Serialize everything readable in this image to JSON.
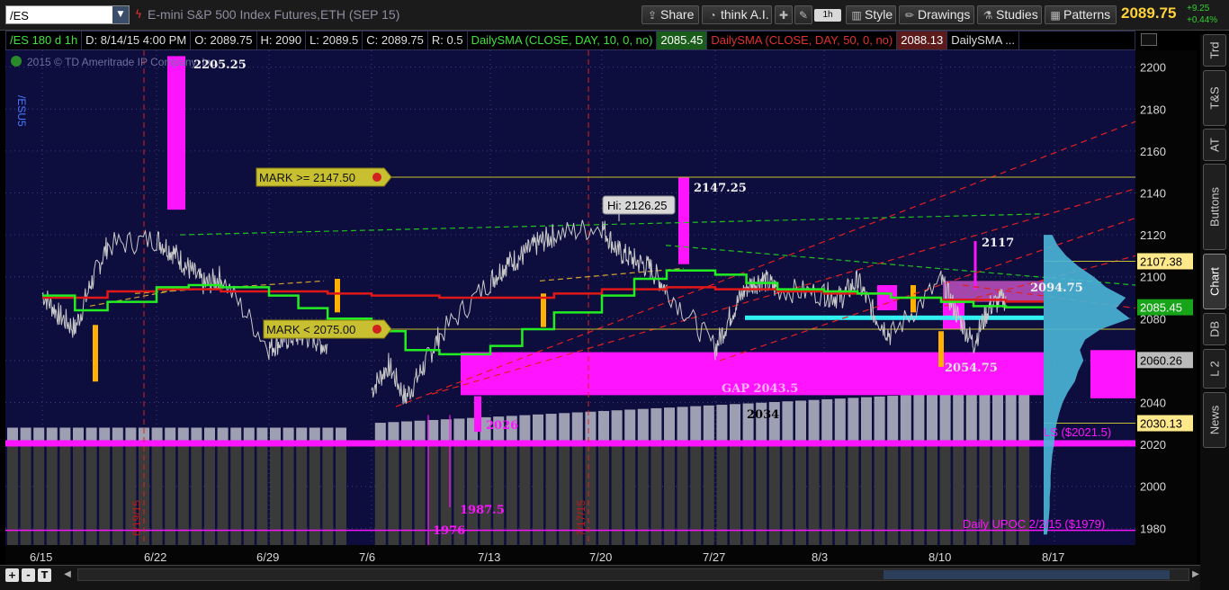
{
  "header": {
    "symbol": "/ES",
    "instrument_title": "E-mini S&P 500 Index Futures,ETH (SEP 15)",
    "share_label": "Share",
    "think_ai_label": "think A.I.",
    "timeframe_label": "1h",
    "style_label": "Style",
    "drawings_label": "Drawings",
    "studies_label": "Studies",
    "patterns_label": "Patterns",
    "last_price": "2089.75",
    "change": "+9.25",
    "change_pct": "+0.44%"
  },
  "infobar": {
    "symbol_tf": "/ES 180 d 1h",
    "date": "D: 8/14/15 4:00 PM",
    "open": "O: 2089.75",
    "high": "H: 2090",
    "low": "L: 2089.5",
    "close": "C: 2089.75",
    "range": "R: 0.5",
    "sma10_label": "DailySMA (CLOSE, DAY, 10, 0, no)",
    "sma10_value": "2085.45",
    "sma50_label": "DailySMA (CLOSE, DAY, 50, 0, no)",
    "sma50_value": "2088.13",
    "sma_more": "DailySMA ..."
  },
  "side_tabs": [
    "Trd",
    "T&S",
    "AT",
    "Buttons",
    "Chart",
    "DB",
    "L 2",
    "News"
  ],
  "active_tab": "Chart",
  "bottom_tools": {
    "zoom_in": "+",
    "zoom_out": "-",
    "text": "T"
  },
  "colors": {
    "background": "#0e0e3e",
    "sma10": "#22ee22",
    "sma50": "#e01818",
    "price": "#c9c9c9",
    "magenta": "#ff14ff",
    "volume_profile": "#4ab6d8",
    "mark_line": "#c8c030",
    "bubble_bg": "#c8c030",
    "bubble_text": "#111111",
    "label_white": "#f0f0f0",
    "cyan_band": "#30f0f0",
    "orange_bar": "#ffb000",
    "last_price_up": "#ffd23a",
    "change_up": "#2fd12f"
  },
  "chart_data": {
    "type": "line",
    "watermark": "2015 © TD Ameritrade IP Company, Inc.",
    "side_label": "/ESU5",
    "ylim": [
      1972,
      2208
    ],
    "y_ticks": [
      2200,
      2180,
      2160,
      2140,
      2120,
      2100,
      2080,
      2060,
      2040,
      2020,
      2000,
      1980
    ],
    "x_ticks": [
      "6/15",
      "6/22",
      "6/29",
      "7/6",
      "7/13",
      "7/20",
      "7/27",
      "8/3",
      "8/10",
      "8/17"
    ],
    "vertical_markers": [
      "6/19/15",
      "7/17/15"
    ],
    "annotations": [
      "2205.25",
      "2147.25",
      "Hi: 2126.25",
      "2117",
      "2094.75",
      "GAP 2043.5",
      "2034",
      "2026",
      "2054.75",
      "1987.5",
      "1976"
    ],
    "alerts": [
      "MARK >= 2147.50",
      "MARK < 2075.00"
    ],
    "price_tags": [
      {
        "label": "2107.38",
        "value": 2107.38,
        "color": "#ffe98a"
      },
      {
        "label": "2085.45",
        "value": 2085.45,
        "color": "#18a418"
      },
      {
        "label": "2060.26",
        "value": 2060.26,
        "color": "#bbbbbb"
      },
      {
        "label": "2030.13",
        "value": 2030.13,
        "color": "#ffe98a"
      }
    ],
    "profile_labels": [
      "LS ($2021.5)",
      "Daily UPOC 2/2/15 ($1979)"
    ],
    "horizontal_levels": {
      "mark_high": 2147.5,
      "mark_low": 2075.0,
      "ls": 2021.5,
      "upoc": 1979
    },
    "series": [
      {
        "name": "DailySMA (CLOSE, DAY, 10, 0, no)",
        "x": [
          "6/15",
          "6/17",
          "6/19",
          "6/22",
          "6/24",
          "6/26",
          "6/29",
          "7/1",
          "7/3",
          "7/6",
          "7/8",
          "7/10",
          "7/13",
          "7/15",
          "7/17",
          "7/20",
          "7/22",
          "7/24",
          "7/27",
          "7/29",
          "7/31",
          "8/3",
          "8/5",
          "8/7",
          "8/10",
          "8/12",
          "8/14"
        ],
        "y": [
          2091,
          2084,
          2088,
          2095,
          2096,
          2095,
          2091,
          2085,
          2080,
          2074,
          2065,
          2063,
          2067,
          2075,
          2083,
          2091,
          2099,
          2103,
          2101,
          2097,
          2094,
          2093,
          2092,
          2090,
          2088,
          2086,
          2085.45
        ]
      },
      {
        "name": "DailySMA (CLOSE, DAY, 50, 0, no)",
        "x": [
          "6/15",
          "6/19",
          "6/22",
          "6/26",
          "6/29",
          "7/3",
          "7/6",
          "7/10",
          "7/13",
          "7/17",
          "7/20",
          "7/24",
          "7/27",
          "7/31",
          "8/3",
          "8/7",
          "8/10",
          "8/14"
        ],
        "y": [
          2090,
          2093,
          2094,
          2093,
          2093,
          2092,
          2091,
          2090,
          2090,
          2092,
          2094,
          2095,
          2094,
          2093,
          2092,
          2090,
          2089,
          2088.13
        ]
      },
      {
        "name": "/ES",
        "x": [
          "6/15",
          "6/16",
          "6/17",
          "6/18",
          "6/19",
          "6/22",
          "6/23",
          "6/24",
          "6/25",
          "6/26",
          "6/29",
          "6/30",
          "7/1",
          "7/2",
          "7/3",
          "7/6",
          "7/7",
          "7/8",
          "7/9",
          "7/10",
          "7/13",
          "7/14",
          "7/15",
          "7/16",
          "7/17",
          "7/20",
          "7/21",
          "7/22",
          "7/23",
          "7/24",
          "7/27",
          "7/28",
          "7/29",
          "7/30",
          "7/31",
          "8/3",
          "8/4",
          "8/5",
          "8/6",
          "8/7",
          "8/10",
          "8/11",
          "8/12",
          "8/13",
          "8/14"
        ],
        "y": [
          2092,
          2082,
          2075,
          2097,
          2115,
          2118,
          2112,
          2104,
          2096,
          2100,
          2066,
          2070,
          2072,
          2071,
          2066,
          2046,
          2058,
          2042,
          2056,
          2072,
          2098,
          2106,
          2110,
          2116,
          2120,
          2124,
          2112,
          2108,
          2104,
          2094,
          2066,
          2082,
          2095,
          2099,
          2094,
          2092,
          2090,
          2098,
          2082,
          2072,
          2098,
          2082,
          2068,
          2086,
          2089.75
        ]
      }
    ],
    "volume_profile": {
      "price": [
        2120,
        2115,
        2110,
        2105,
        2100,
        2095,
        2090,
        2085,
        2080,
        2075,
        2070,
        2065,
        2060,
        2055,
        2050,
        2045,
        2040,
        2035,
        2030,
        2025,
        2020,
        2015,
        2010,
        2005,
        2000,
        1995,
        1990,
        1985,
        1980,
        1977
      ],
      "volume": [
        10,
        16,
        26,
        40,
        58,
        72,
        95,
        84,
        100,
        66,
        48,
        42,
        46,
        40,
        36,
        28,
        22,
        18,
        15,
        13,
        12,
        10,
        9,
        8,
        8,
        7,
        7,
        6,
        5,
        4
      ]
    }
  }
}
